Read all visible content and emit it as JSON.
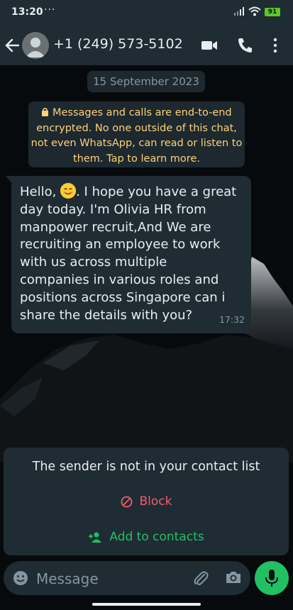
{
  "status_bar": {
    "time": "13:20",
    "notification_dots": "···",
    "battery": "91",
    "icons": [
      "signal-icon",
      "wifi-icon",
      "battery-icon"
    ]
  },
  "header": {
    "contact_name": "+1 (249) 573-5102",
    "icons": [
      "back-arrow-icon",
      "avatar",
      "video-call-icon",
      "phone-call-icon",
      "more-options-icon"
    ]
  },
  "chat": {
    "date_chip": "15 September 2023",
    "encryption_notice": {
      "line1": "Messages and calls are end-to-end",
      "line2": "encrypted. No one outside of this chat,",
      "line3": "not even WhatsApp, can read or listen to",
      "line4": "them. Tap to learn more.",
      "icon": "lock-icon"
    },
    "message": {
      "greeting": "Hello,",
      "emoji": "smiling-face-emoji",
      "body_after_emoji": ". I hope you have a great",
      "line2": "day today. I'm Olivia HR from",
      "line3": "manpower recruit,And We are",
      "line4": "recruiting an employee to work",
      "line5": "with us across multiple",
      "line6": "companies in various roles and",
      "line7": "positions across Singapore can i",
      "line8": "share the details with you?",
      "time": "17:32"
    }
  },
  "unknown_sender_panel": {
    "notice": "The sender is not in your contact list",
    "block_label": "Block",
    "add_label": "Add to contacts"
  },
  "composer": {
    "placeholder": "Message",
    "icons": [
      "emoji-icon",
      "attach-icon",
      "camera-icon",
      "mic-icon"
    ]
  },
  "colors": {
    "header_bg": "#1f2c34",
    "bubble_bg": "#1f2c34",
    "encryption_text": "#ffd279",
    "block_red": "#f15c6d",
    "accent_green": "#21c063"
  }
}
